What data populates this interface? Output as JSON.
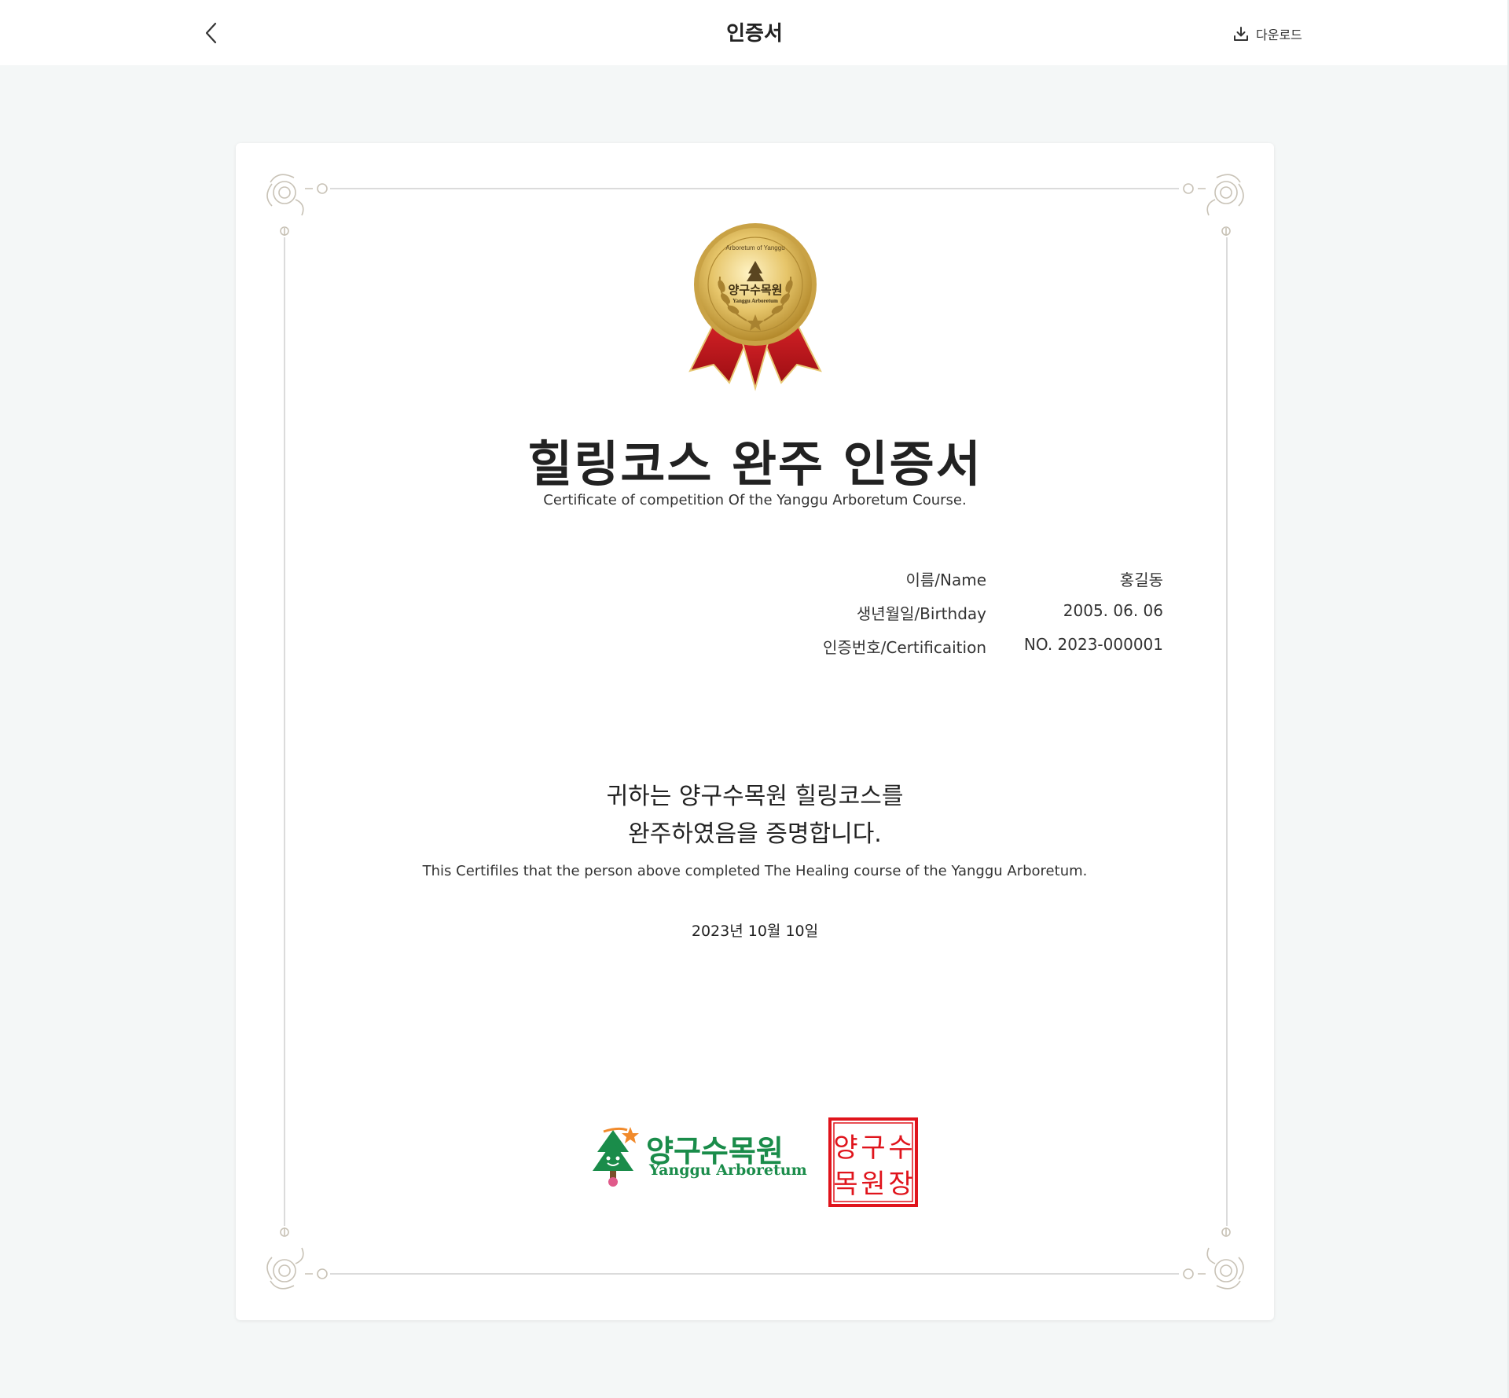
{
  "header": {
    "title": "인증서",
    "download_label": "다운로드"
  },
  "certificate": {
    "medal": {
      "top_text": "Arboretum of Yanggu",
      "ko_text": "양구수목원",
      "en_text": "Yanggu Arboretum"
    },
    "title": "힐링코스 완주 인증서",
    "subtitle": "Certificate of competition Of the Yanggu Arboretum Course.",
    "info": [
      {
        "label": "이름/Name",
        "value": "홍길동"
      },
      {
        "label": "생년월일/Birthday",
        "value": "2005. 06. 06"
      },
      {
        "label": "인증번호/Certificaition",
        "value": "NO. 2023-000001"
      }
    ],
    "statement_line1": "귀하는 양구수목원 힐링코스를",
    "statement_line2": "완주하였음을 증명합니다.",
    "statement_en": "This Certifiles that the person above completed The Healing course of the Yanggu Arboretum.",
    "issue_date": "2023년 10월 10일",
    "logo": {
      "ko": "양구수목원",
      "en": "Yanggu Arboretum"
    },
    "seal": {
      "chars": [
        "양",
        "구",
        "수",
        "목",
        "원",
        "장"
      ]
    }
  },
  "colors": {
    "page_background": "#f4f7f7",
    "medal_gold": "#d9b24a",
    "ribbon_red": "#c4161c",
    "logo_green": "#1a8c4a",
    "seal_red": "#e0141c"
  }
}
